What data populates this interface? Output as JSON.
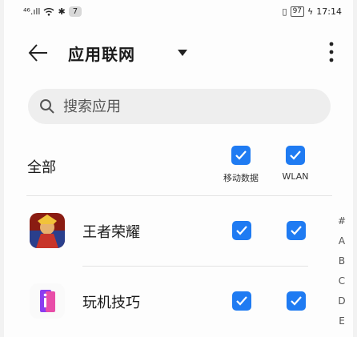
{
  "status_bar": {
    "signal_text": "⁴⁶.ıll",
    "notif_count": "7",
    "battery": "97",
    "time": "17:14"
  },
  "header": {
    "title": "应用联网"
  },
  "search": {
    "placeholder": "搜索应用",
    "value": ""
  },
  "all": {
    "label": "全部",
    "col_mobile": "移动数据",
    "col_wlan": "WLAN"
  },
  "apps": [
    {
      "name": "王者荣耀",
      "mobile": true,
      "wlan": true
    },
    {
      "name": "玩机技巧",
      "mobile": true,
      "wlan": true
    }
  ],
  "index": [
    "#",
    "A",
    "B",
    "C",
    "D",
    "E"
  ],
  "colors": {
    "accent": "#1f7bf2",
    "bg": "#fdfdfd"
  },
  "icons": [
    "back-arrow-icon",
    "dropdown-triangle-icon",
    "more-vert-icon",
    "search-icon",
    "check-icon"
  ]
}
